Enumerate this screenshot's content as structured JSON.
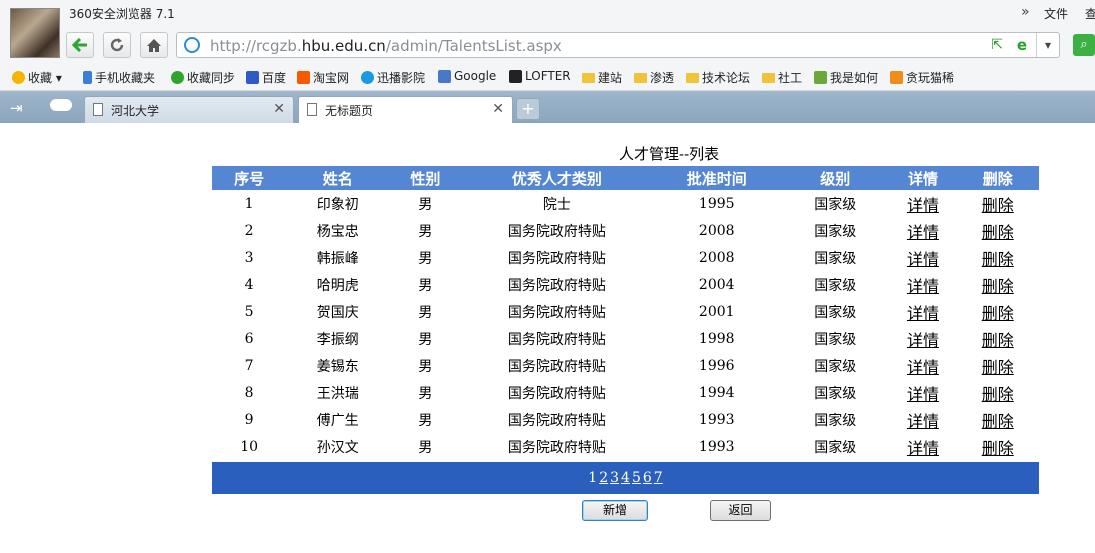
{
  "window": {
    "app_title": "360安全浏览器 7.1",
    "menu_file": "文件",
    "menu_view": "查"
  },
  "address": {
    "prefix": "http://rcgzb.",
    "domain": "hbu.edu.cn",
    "path": "/admin/TalentsList.aspx"
  },
  "bookmarks": [
    "收藏",
    "手机收藏夹",
    "收藏同步",
    "百度",
    "淘宝网",
    "迅播影院",
    "Google",
    "LOFTER",
    "建站",
    "渗透",
    "技术论坛",
    "社工",
    "我是如何",
    "贪玩猫稀"
  ],
  "tabs": [
    {
      "label": "河北大学"
    },
    {
      "label": "无标题页"
    }
  ],
  "page": {
    "title": "人才管理--列表"
  },
  "table": {
    "headers": [
      "序号",
      "姓名",
      "性别",
      "优秀人才类别",
      "批准时间",
      "级别",
      "详情",
      "删除"
    ],
    "rows": [
      [
        "1",
        "印象初",
        "男",
        "院士",
        "1995",
        "国家级",
        "详情",
        "删除"
      ],
      [
        "2",
        "杨宝忠",
        "男",
        "国务院政府特贴",
        "2008",
        "国家级",
        "详情",
        "删除"
      ],
      [
        "3",
        "韩振峰",
        "男",
        "国务院政府特贴",
        "2008",
        "国家级",
        "详情",
        "删除"
      ],
      [
        "4",
        "哈明虎",
        "男",
        "国务院政府特贴",
        "2004",
        "国家级",
        "详情",
        "删除"
      ],
      [
        "5",
        "贺国庆",
        "男",
        "国务院政府特贴",
        "2001",
        "国家级",
        "详情",
        "删除"
      ],
      [
        "6",
        "李振纲",
        "男",
        "国务院政府特贴",
        "1998",
        "国家级",
        "详情",
        "删除"
      ],
      [
        "7",
        "姜锡东",
        "男",
        "国务院政府特贴",
        "1996",
        "国家级",
        "详情",
        "删除"
      ],
      [
        "8",
        "王洪瑞",
        "男",
        "国务院政府特贴",
        "1994",
        "国家级",
        "详情",
        "删除"
      ],
      [
        "9",
        "傅广生",
        "男",
        "国务院政府特贴",
        "1993",
        "国家级",
        "详情",
        "删除"
      ],
      [
        "10",
        "孙汉文",
        "男",
        "国务院政府特贴",
        "1993",
        "国家级",
        "详情",
        "删除"
      ]
    ]
  },
  "pager": {
    "pages": [
      "1",
      "2",
      "3",
      "4",
      "5",
      "6",
      "7"
    ],
    "current": "1"
  },
  "buttons": {
    "add": "新增",
    "back": "返回"
  },
  "colors": {
    "header_bg": "#5586d3",
    "pager_bg": "#2b5fbd",
    "tab_bar": "#8aa5bd"
  }
}
